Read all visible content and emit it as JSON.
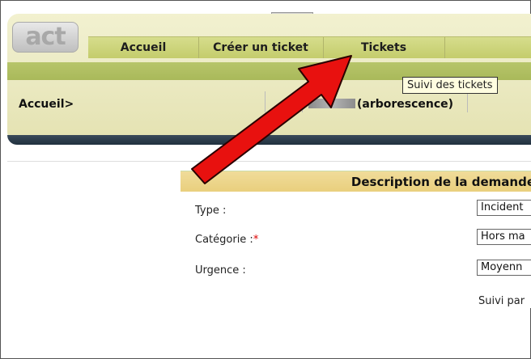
{
  "app": {
    "logo_text": "act"
  },
  "menu": {
    "items": [
      {
        "label": "Accueil"
      },
      {
        "label": "Créer un ticket"
      },
      {
        "label": "Tickets"
      }
    ]
  },
  "tooltip": "Suivi des tickets",
  "breadcrumb": "Accueil>",
  "tree_link": "(arborescence)",
  "form": {
    "title": "Description de la demande",
    "fields": [
      {
        "label": "Type :",
        "value": "Incident"
      },
      {
        "label": "Catégorie :",
        "required_mark": "*",
        "value": "Hors ma"
      },
      {
        "label": "Urgence :",
        "value": "Moyenn"
      }
    ],
    "suivi_label": "Suivi par"
  },
  "colors": {
    "menu_bar": "#c8d06e",
    "header_bg": "#efeecc",
    "form_header": "#ebd27f",
    "arrow": "#e8110f"
  }
}
